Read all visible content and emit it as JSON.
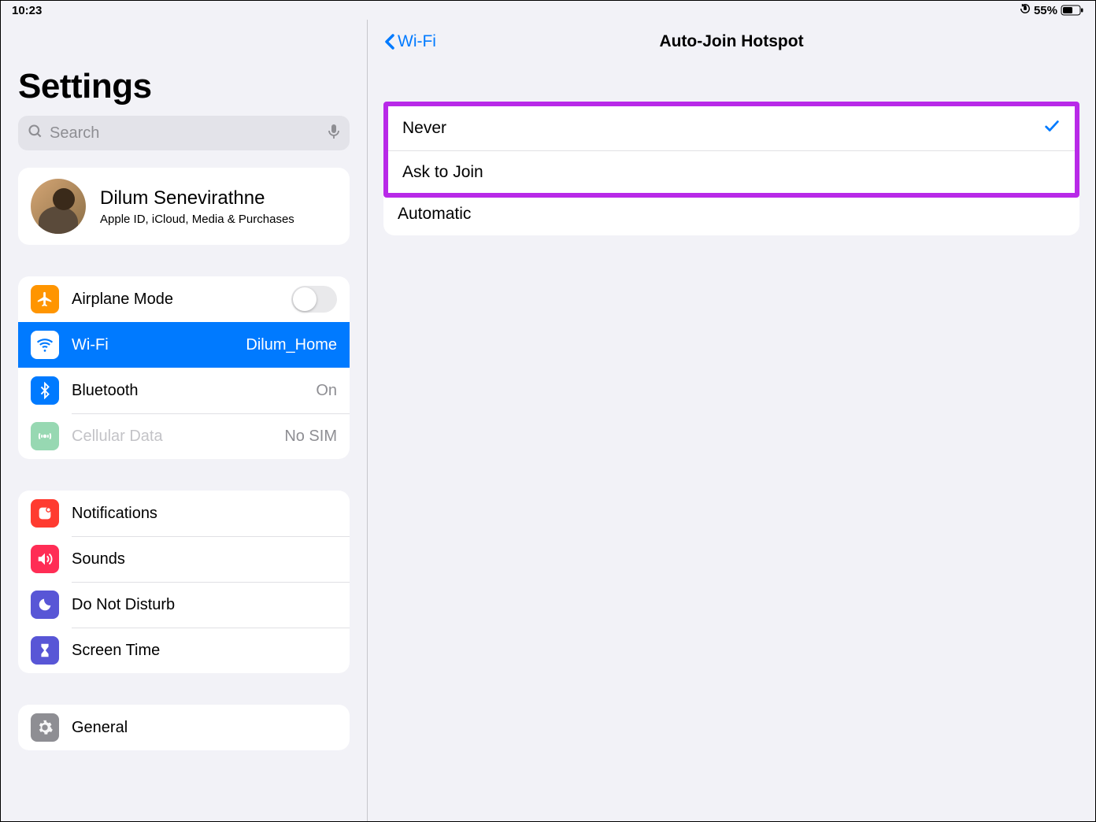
{
  "status_bar": {
    "time": "10:23",
    "battery_percent": "55%"
  },
  "sidebar": {
    "title": "Settings",
    "search_placeholder": "Search",
    "profile": {
      "name": "Dilum Senevirathne",
      "subtitle": "Apple ID, iCloud, Media & Purchases"
    },
    "group_connectivity": [
      {
        "icon": "airplane",
        "label": "Airplane Mode",
        "control": "switch",
        "on": false
      },
      {
        "icon": "wifi",
        "label": "Wi-Fi",
        "value": "Dilum_Home",
        "selected": true
      },
      {
        "icon": "bluetooth",
        "label": "Bluetooth",
        "value": "On"
      },
      {
        "icon": "cellular",
        "label": "Cellular Data",
        "value": "No SIM",
        "disabled": true
      }
    ],
    "group_notifications": [
      {
        "icon": "notifications",
        "label": "Notifications"
      },
      {
        "icon": "sounds",
        "label": "Sounds"
      },
      {
        "icon": "dnd",
        "label": "Do Not Disturb"
      },
      {
        "icon": "screentime",
        "label": "Screen Time"
      }
    ],
    "group_general": [
      {
        "icon": "general",
        "label": "General"
      }
    ]
  },
  "detail": {
    "back_label": "Wi-Fi",
    "title": "Auto-Join Hotspot",
    "options": [
      {
        "label": "Never",
        "selected": true
      },
      {
        "label": "Ask to Join",
        "selected": false
      },
      {
        "label": "Automatic",
        "selected": false
      }
    ]
  }
}
